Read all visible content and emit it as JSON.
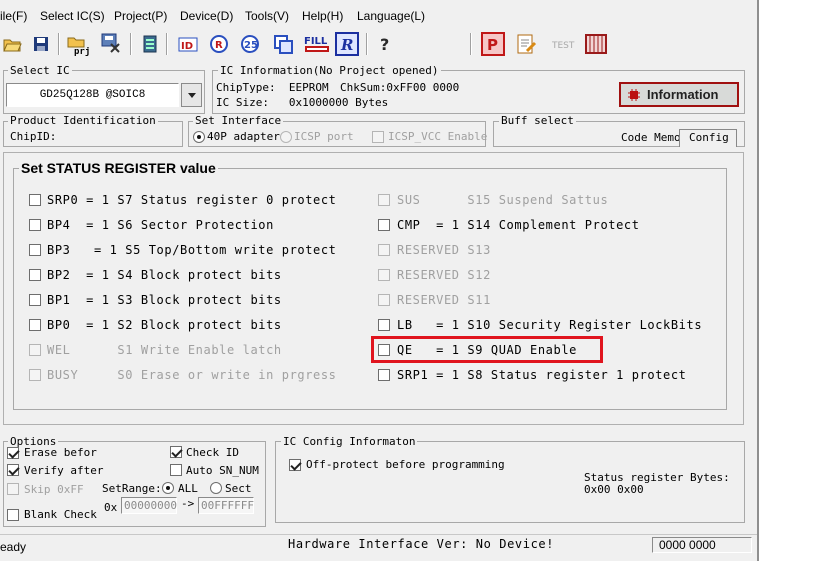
{
  "menu": [
    "ile(F)",
    "Select IC(S)",
    "Project(P)",
    "Device(D)",
    "Tools(V)",
    "Help(H)",
    "Language(L)"
  ],
  "select_ic": {
    "label": "Select IC",
    "value": "GD25Q128B @SOIC8"
  },
  "ic_info": {
    "label": "IC Information(No Project opened)",
    "chip_type": "ChipType:  EEPROM",
    "chksum": "ChkSum:0xFF00 0000",
    "ic_size": "IC Size:   0x1000000 Bytes",
    "button": "Information"
  },
  "product_id": {
    "label": "Product Identification",
    "chip_id": "ChipID:"
  },
  "set_interface": {
    "label": "Set Interface",
    "options": [
      "40P adapter",
      "ICSP port",
      "ICSP_VCC Enable"
    ]
  },
  "buff_select": {
    "label": "Buff select",
    "tabs": [
      "Code Memo",
      "Config"
    ]
  },
  "status_register": {
    "title": "Set STATUS REGISTER value",
    "left": [
      {
        "text": "SRP0 = 1 S7 Status register 0 protect",
        "enabled": true
      },
      {
        "text": "BP4  = 1 S6 Sector Protection",
        "enabled": true
      },
      {
        "text": "BP3   = 1 S5 Top/Bottom write protect",
        "enabled": true
      },
      {
        "text": "BP2  = 1 S4 Block protect bits",
        "enabled": true
      },
      {
        "text": "BP1  = 1 S3 Block protect bits",
        "enabled": true
      },
      {
        "text": "BP0  = 1 S2 Block protect bits",
        "enabled": true
      },
      {
        "text": "WEL      S1 Write Enable latch",
        "enabled": false
      },
      {
        "text": "BUSY     S0 Erase or write in prgress",
        "enabled": false
      }
    ],
    "right": [
      {
        "text": "SUS      S15 Suspend Sattus",
        "enabled": false
      },
      {
        "text": "CMP  = 1 S14 Complement Protect",
        "enabled": true
      },
      {
        "text": "RESERVED S13",
        "enabled": false
      },
      {
        "text": "RESERVED S12",
        "enabled": false
      },
      {
        "text": "RESERVED S11",
        "enabled": false
      },
      {
        "text": "LB   = 1 S10 Security Register LockBits",
        "enabled": true
      },
      {
        "text": "QE   = 1 S9 QUAD Enable",
        "enabled": true,
        "highlighted": true
      },
      {
        "text": "SRP1 = 1 S8 Status register 1 protect",
        "enabled": true
      }
    ]
  },
  "options": {
    "label": "Options",
    "erase_before": "Erase befor",
    "verify_after": "Verify after",
    "skip_0xff": "Skip 0xFF",
    "blank_check": "Blank Check",
    "check_id": "Check ID",
    "auto_sn": "Auto SN_NUM",
    "setrange_label": "SetRange:",
    "range_all": "ALL",
    "range_sect": "Sect",
    "range_prefix": "0x",
    "range_start": "00000000",
    "range_arrow": "->",
    "range_end": "00FFFFFF"
  },
  "ic_config": {
    "label": "IC Config Informaton",
    "off_protect": "Off-protect before programming",
    "status_bytes_label": "Status register Bytes:",
    "status_bytes_value": "0x00 0x00"
  },
  "status_bar": {
    "left": "eady",
    "center": "Hardware Interface Ver: No Device!",
    "right": "0000 0000"
  },
  "colors": {
    "highlight": "#e0141e",
    "info_button": "#d8dad8"
  }
}
